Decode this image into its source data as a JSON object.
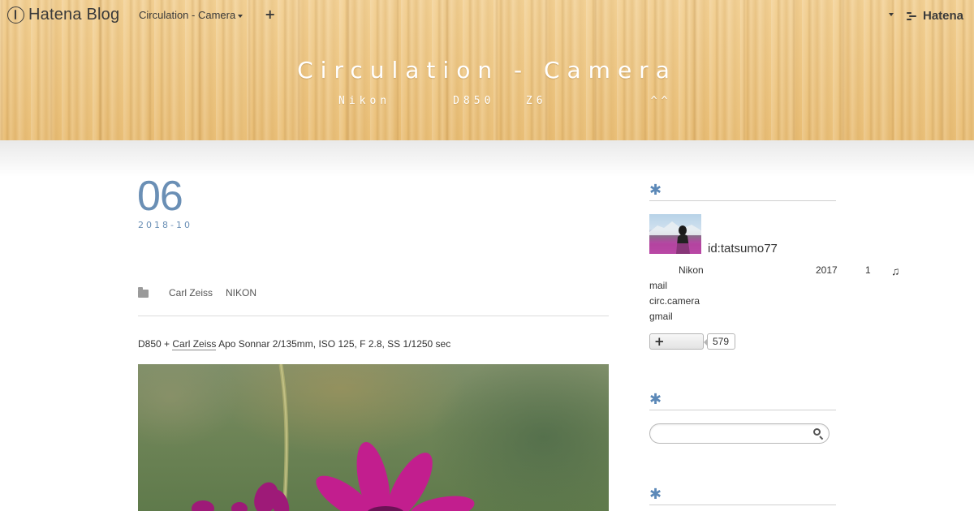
{
  "globalnav": {
    "logo": "Hatena Blog",
    "blog_menu": "Circulation - Camera",
    "plus_glyph": "+",
    "hatena_logo": "Hatena"
  },
  "blog": {
    "title": "Circulation - Camera",
    "description": "Nikon      D850   Z6          ^^"
  },
  "entry": {
    "date_day": "06",
    "date_ym": "2018-10",
    "categories": [
      "Carl Zeiss",
      "NIKON"
    ],
    "caption_pre": "D850 + ",
    "caption_link": "Carl Zeiss",
    "caption_post": " Apo Sonnar 2/135mm, ISO 125, F 2.8, SS 1/1250 sec"
  },
  "sidebar": {
    "heading_glyph": "✱",
    "profile": {
      "user_id": "id:tatsumo77",
      "line_a": "Nikon",
      "line_b": "2017",
      "line_c": "1",
      "line_d": "♫",
      "contact_1": "mail",
      "contact_2": "circ.camera",
      "contact_3": "gmail",
      "follow_plus": "+",
      "reader_count": "579"
    },
    "search": {
      "placeholder": ""
    }
  },
  "colors": {
    "accent": "#6a8fb5",
    "asterisk": "#5c89b8",
    "wood": "#eac27d"
  }
}
